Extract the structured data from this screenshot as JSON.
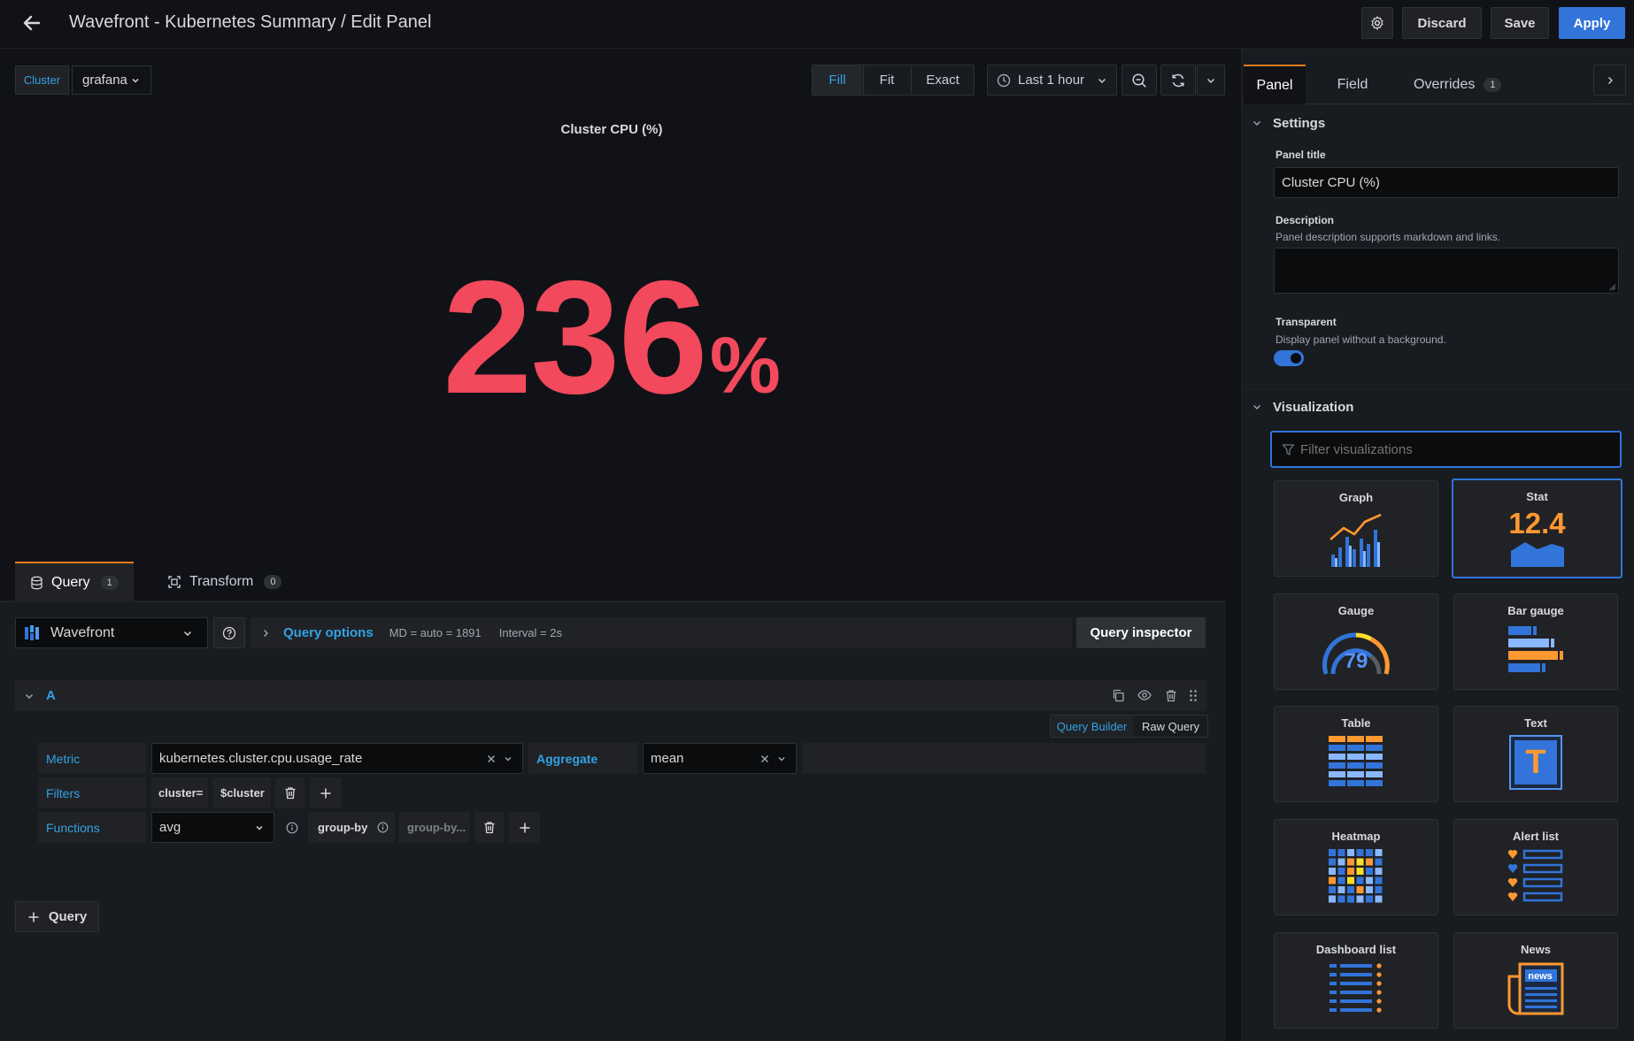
{
  "header": {
    "title": "Wavefront - Kubernetes Summary / Edit Panel",
    "discard_label": "Discard",
    "save_label": "Save",
    "apply_label": "Apply"
  },
  "toolbar": {
    "cluster_label": "Cluster",
    "cluster_value": "grafana",
    "fill_label": "Fill",
    "fit_label": "Fit",
    "exact_label": "Exact",
    "time_range": "Last 1 hour"
  },
  "panel": {
    "title": "Cluster CPU (%)",
    "value": "236",
    "unit": "%",
    "value_color": "#f2495c"
  },
  "query_tabs": {
    "query_label": "Query",
    "query_count": "1",
    "transform_label": "Transform",
    "transform_count": "0"
  },
  "datasource": {
    "name": "Wavefront",
    "query_options_label": "Query options",
    "md_text": "MD = auto = 1891",
    "interval_text": "Interval = 2s",
    "inspector_label": "Query inspector"
  },
  "query_a": {
    "ref": "A",
    "builder_label": "Query Builder",
    "raw_label": "Raw Query",
    "metric_label": "Metric",
    "metric_value": "kubernetes.cluster.cpu.usage_rate",
    "aggregate_label": "Aggregate",
    "aggregate_value": "mean",
    "filters_label": "Filters",
    "filter_key": "cluster=",
    "filter_value": "$cluster",
    "functions_label": "Functions",
    "function_value": "avg",
    "groupby_label": "group-by",
    "groupby_placeholder": "group-by..."
  },
  "add_query_label": "Query",
  "sidebar": {
    "tabs": [
      {
        "label": "Panel"
      },
      {
        "label": "Field"
      },
      {
        "label": "Overrides",
        "count": "1"
      }
    ],
    "settings_label": "Settings",
    "panel_title_label": "Panel title",
    "panel_title_value": "Cluster CPU (%)",
    "description_label": "Description",
    "description_hint": "Panel description supports markdown and links.",
    "transparent_label": "Transparent",
    "transparent_hint": "Display panel without a background.",
    "transparent_on": true,
    "visualization_label": "Visualization",
    "filter_placeholder": "Filter visualizations",
    "visualizations": [
      {
        "name": "Graph",
        "icon": "graph-icon"
      },
      {
        "name": "Stat",
        "icon": "stat-icon",
        "sample": "12.4",
        "selected": true
      },
      {
        "name": "Gauge",
        "icon": "gauge-icon",
        "sample": "79"
      },
      {
        "name": "Bar gauge",
        "icon": "bar-gauge-icon"
      },
      {
        "name": "Table",
        "icon": "table-icon"
      },
      {
        "name": "Text",
        "icon": "text-icon",
        "sample": "T"
      },
      {
        "name": "Heatmap",
        "icon": "heatmap-icon"
      },
      {
        "name": "Alert list",
        "icon": "alert-list-icon"
      },
      {
        "name": "Dashboard list",
        "icon": "dashboard-list-icon"
      },
      {
        "name": "News",
        "icon": "news-icon",
        "sample": "news"
      }
    ]
  },
  "colors": {
    "accent_blue": "#3274d9",
    "link_blue": "#33a2e5",
    "red": "#f2495c",
    "orange": "#ff9830",
    "yellow": "#fade2a"
  }
}
